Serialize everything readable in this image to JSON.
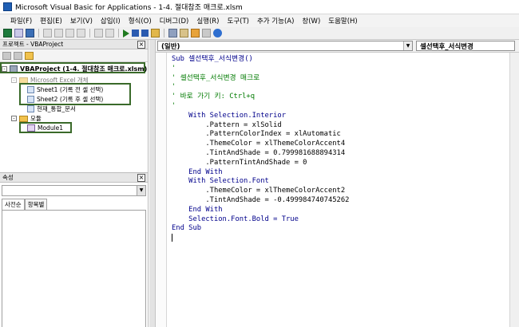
{
  "window": {
    "title": "Microsoft Visual Basic for Applications - 1-4. 절대참조 매크로.xlsm"
  },
  "menu": [
    "파일(F)",
    "편집(E)",
    "보기(V)",
    "삽입(I)",
    "형식(O)",
    "디버그(D)",
    "실행(R)",
    "도구(T)",
    "추가 기능(A)",
    "창(W)",
    "도움말(H)"
  ],
  "project_panel": {
    "title": "프로젝트 - VBAProject",
    "close": "×",
    "tree": {
      "root": "VBAProject (1-4. 절대참조 매크로.xlsm)",
      "folder_objects": "Microsoft Excel 개체",
      "sheet1": "Sheet1 (기록 전 셀 선택)",
      "sheet2": "Sheet2 (기록 후 셀 선택)",
      "thisworkbook": "현재_통합_문서",
      "folder_modules": "모듈",
      "module1": "Module1"
    }
  },
  "props_panel": {
    "title": "속성",
    "close": "×",
    "tab_alpha": "사전순",
    "tab_category": "항목별"
  },
  "code_window": {
    "object_combo": "(일반)",
    "proc_combo": "셀선택후_서식변경",
    "lines": [
      {
        "text": "Sub 셀선택후_서식변경()",
        "kind": "kw"
      },
      {
        "text": "'",
        "kind": "cm"
      },
      {
        "text": "' 셀선택후_서식변경 매크로",
        "kind": "cm"
      },
      {
        "text": "'",
        "kind": "cm"
      },
      {
        "text": "' 바로 가기 키: Ctrl+q",
        "kind": "cm"
      },
      {
        "text": "'",
        "kind": "cm"
      },
      {
        "text": "    With Selection.Interior",
        "kind": "kw"
      },
      {
        "text": "        .Pattern = xlSolid",
        "kind": "tx"
      },
      {
        "text": "        .PatternColorIndex = xlAutomatic",
        "kind": "tx"
      },
      {
        "text": "        .ThemeColor = xlThemeColorAccent4",
        "kind": "tx"
      },
      {
        "text": "        .TintAndShade = 0.799981688894314",
        "kind": "tx"
      },
      {
        "text": "        .PatternTintAndShade = 0",
        "kind": "tx"
      },
      {
        "text": "    End With",
        "kind": "kw"
      },
      {
        "text": "    With Selection.Font",
        "kind": "kw"
      },
      {
        "text": "        .ThemeColor = xlThemeColorAccent2",
        "kind": "tx"
      },
      {
        "text": "        .TintAndShade = -0.499984740745262",
        "kind": "tx"
      },
      {
        "text": "    End With",
        "kind": "kw"
      },
      {
        "text": "    Selection.Font.Bold = True",
        "kind": "kw"
      },
      {
        "text": "End Sub",
        "kind": "kw"
      },
      {
        "text": "",
        "kind": "tx"
      }
    ]
  },
  "colors": {
    "keyword": "#00008b",
    "comment": "#007a00",
    "highlight_box": "#3a6a2a"
  }
}
